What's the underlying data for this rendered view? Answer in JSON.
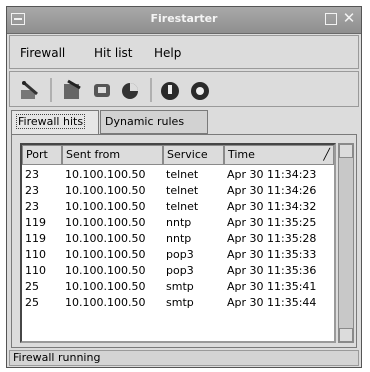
{
  "window": {
    "title": "Firestarter"
  },
  "menubar": {
    "items": [
      "Firewall",
      "Hit list",
      "Help"
    ]
  },
  "toolbar": {
    "buttons": [
      "wizard-icon",
      "preferences-icon",
      "hits-icon",
      "pie-icon",
      "stop-icon",
      "start-icon"
    ]
  },
  "tabs": [
    {
      "label": "Firewall hits",
      "active": true
    },
    {
      "label": "Dynamic rules",
      "active": false
    }
  ],
  "table": {
    "columns": [
      "Port",
      "Sent from",
      "Service",
      "Time"
    ],
    "rows": [
      [
        "23",
        "10.100.100.50",
        "telnet",
        "Apr 30 11:34:23"
      ],
      [
        "23",
        "10.100.100.50",
        "telnet",
        "Apr 30 11:34:26"
      ],
      [
        "23",
        "10.100.100.50",
        "telnet",
        "Apr 30 11:34:32"
      ],
      [
        "119",
        "10.100.100.50",
        "nntp",
        "Apr 30 11:35:25"
      ],
      [
        "119",
        "10.100.100.50",
        "nntp",
        "Apr 30 11:35:28"
      ],
      [
        "110",
        "10.100.100.50",
        "pop3",
        "Apr 30 11:35:33"
      ],
      [
        "110",
        "10.100.100.50",
        "pop3",
        "Apr 30 11:35:36"
      ],
      [
        "25",
        "10.100.100.50",
        "smtp",
        "Apr 30 11:35:41"
      ],
      [
        "25",
        "10.100.100.50",
        "smtp",
        "Apr 30 11:35:44"
      ]
    ]
  },
  "status": {
    "text": "Firewall running"
  }
}
